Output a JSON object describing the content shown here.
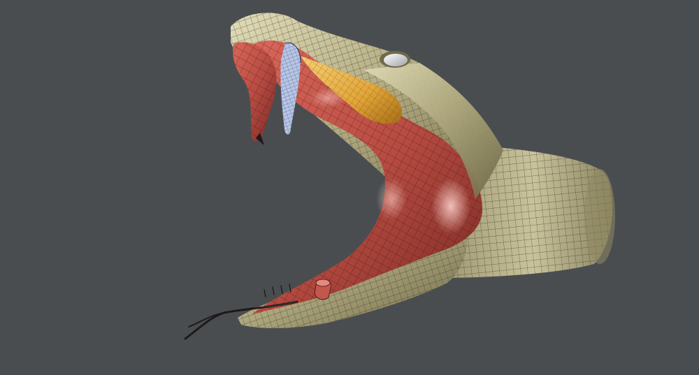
{
  "viewport": {
    "background": "#4a4d50",
    "subject": "snake-head-3d-wireframe-model"
  },
  "colors": {
    "skin": "#b3ac82",
    "skin_dark": "#6f6a48",
    "skin_light": "#e2ddb8",
    "mouth": "#c2574c",
    "mouth_dark": "#7a2a24",
    "mouth_light": "#f0a39a",
    "venom_gland": "#e3a63a",
    "fang": "#b8c6e6",
    "eye": "#d9dbe0",
    "tongue": "#1e1a1a",
    "mesh_line": "#2a2622"
  }
}
